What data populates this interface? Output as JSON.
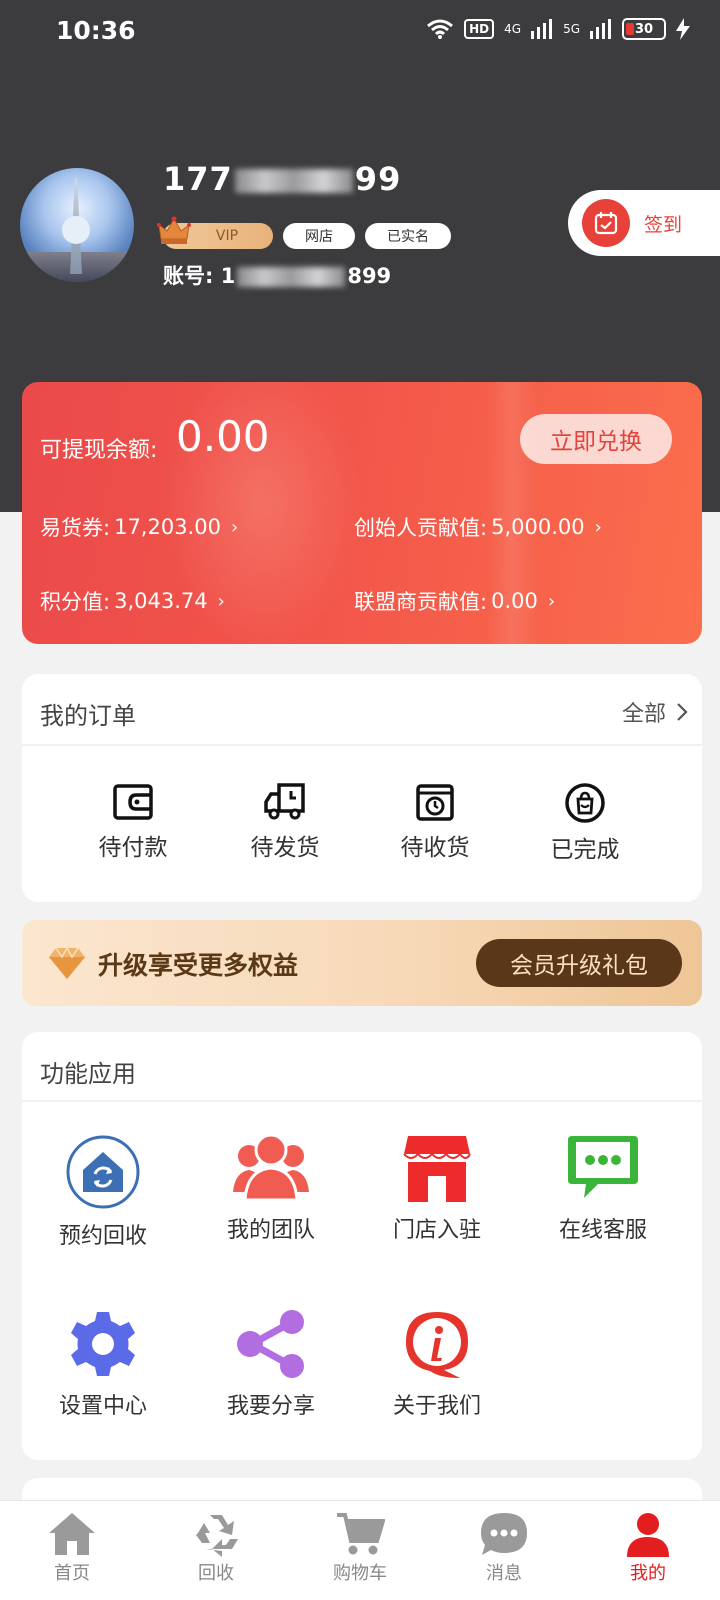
{
  "status_bar": {
    "time": "10:36",
    "net1": "4G",
    "net2": "5G",
    "hd": "HD",
    "battery": "30"
  },
  "profile": {
    "phone_prefix": "177",
    "phone_suffix": "99",
    "vip_label": "VIP",
    "badges": [
      "网店",
      "已实名"
    ],
    "account_prefix": "账号: 1",
    "account_suffix": "899",
    "checkin_label": "签到"
  },
  "balance": {
    "label": "可提现余额:",
    "value": "0.00",
    "exchange_button": "立即兑换",
    "stats": [
      {
        "label": "易货券:",
        "value": "17,203.00"
      },
      {
        "label": "创始人贡献值:",
        "value": "5,000.00"
      },
      {
        "label": "积分值:",
        "value": "3,043.74"
      },
      {
        "label": "联盟商贡献值:",
        "value": "0.00"
      }
    ]
  },
  "orders": {
    "title": "我的订单",
    "see_all": "全部",
    "items": [
      {
        "label": "待付款",
        "icon": "wallet-icon"
      },
      {
        "label": "待发货",
        "icon": "truck-icon"
      },
      {
        "label": "待收货",
        "icon": "box-clock-icon"
      },
      {
        "label": "已完成",
        "icon": "bag-check-icon"
      }
    ]
  },
  "upgrade": {
    "text": "升级享受更多权益",
    "button": "会员升级礼包"
  },
  "functions": {
    "title": "功能应用",
    "items": [
      {
        "label": "预约回收",
        "icon": "recycle-house-icon",
        "color": "#3d6fb5"
      },
      {
        "label": "我的团队",
        "icon": "team-icon",
        "color": "#f05b52"
      },
      {
        "label": "门店入驻",
        "icon": "store-icon",
        "color": "#ee2b2b"
      },
      {
        "label": "在线客服",
        "icon": "chat-icon",
        "color": "#3ab53a"
      },
      {
        "label": "设置中心",
        "icon": "gear-icon",
        "color": "#5b6ae6"
      },
      {
        "label": "我要分享",
        "icon": "share-icon",
        "color": "#b26ee0"
      },
      {
        "label": "关于我们",
        "icon": "info-icon",
        "color": "#e6332b"
      }
    ]
  },
  "bottom_nav": {
    "items": [
      {
        "label": "首页",
        "icon": "home-icon"
      },
      {
        "label": "回收",
        "icon": "recycle-icon"
      },
      {
        "label": "购物车",
        "icon": "cart-icon"
      },
      {
        "label": "消息",
        "icon": "message-icon"
      },
      {
        "label": "我的",
        "icon": "user-icon",
        "active": true
      }
    ]
  },
  "colors": {
    "header_bg": "#3c3c3e",
    "accent_red": "#e8413a",
    "card_gradient_start": "#ea4a4a",
    "card_gradient_end": "#fb6e4c",
    "active_nav": "#e31e1e"
  }
}
